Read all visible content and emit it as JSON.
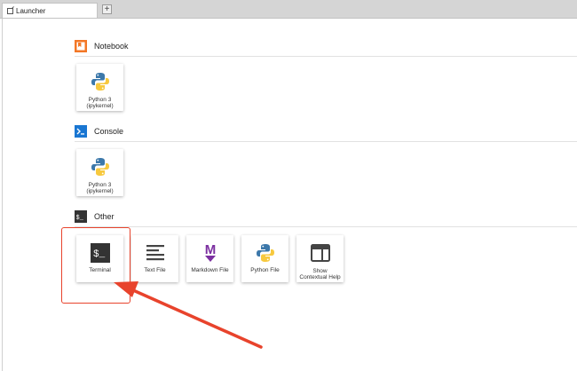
{
  "tabbar": {
    "active_tab": "Launcher",
    "add_tab_glyph": "+"
  },
  "sections": {
    "notebook": {
      "title": "Notebook",
      "icon": "notebook-icon",
      "icon_color": "#f37726"
    },
    "console": {
      "title": "Console",
      "icon": "console-icon",
      "icon_color": "#1976d2"
    },
    "other": {
      "title": "Other",
      "icon": "terminal-icon"
    }
  },
  "cards": {
    "notebook_python": {
      "line1": "Python 3",
      "line2": "(ipykernel)"
    },
    "console_python": {
      "line1": "Python 3",
      "line2": "(ipykernel)"
    },
    "terminal": {
      "label": "Terminal",
      "glyph": "$_"
    },
    "text_file": {
      "label": "Text File"
    },
    "markdown_file": {
      "label": "Markdown File",
      "glyph": "M"
    },
    "python_file": {
      "label": "Python File"
    },
    "contextual_help": {
      "line1": "Show",
      "line2": "Contextual Help"
    }
  },
  "annotation": {
    "color": "#e8432c"
  }
}
